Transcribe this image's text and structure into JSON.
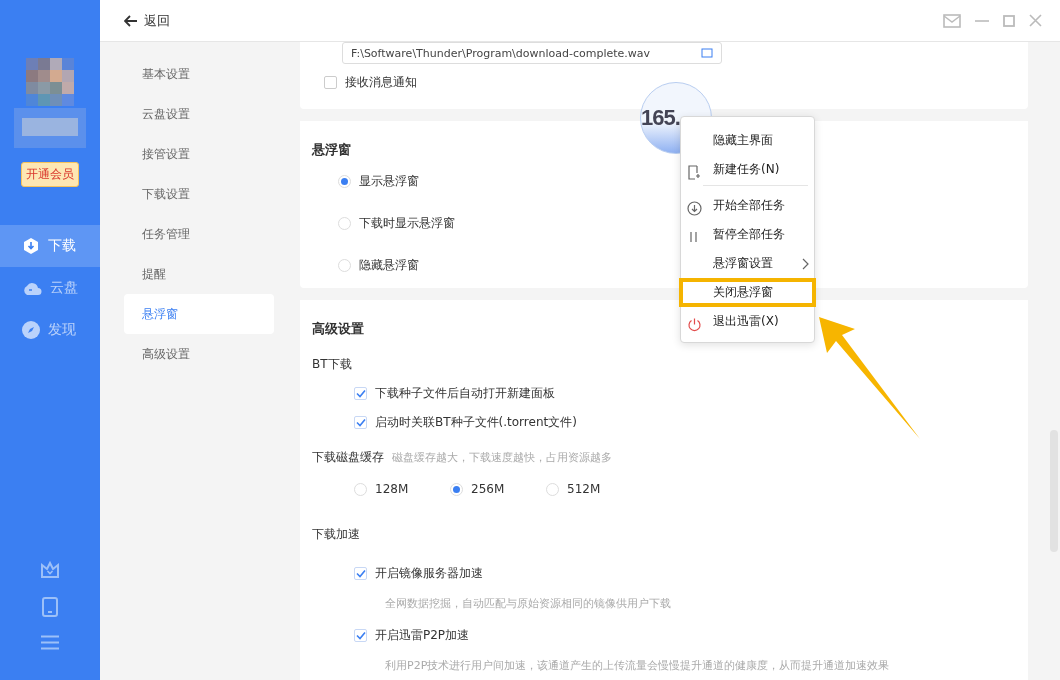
{
  "sidebar": {
    "vip_button": "开通会员",
    "nav": [
      {
        "label": "下载",
        "kind": "download",
        "selected": true
      },
      {
        "label": "云盘",
        "kind": "cloud",
        "selected": false
      },
      {
        "label": "发现",
        "kind": "discover",
        "selected": false
      }
    ]
  },
  "header": {
    "back": "返回"
  },
  "settings_nav": [
    {
      "label": "基本设置",
      "selected": false
    },
    {
      "label": "云盘设置",
      "selected": false
    },
    {
      "label": "接管设置",
      "selected": false
    },
    {
      "label": "下载设置",
      "selected": false
    },
    {
      "label": "任务管理",
      "selected": false
    },
    {
      "label": "提醒",
      "selected": false
    },
    {
      "label": "悬浮窗",
      "selected": true
    },
    {
      "label": "高级设置",
      "selected": false
    }
  ],
  "notify_card": {
    "sound_path": "F:\\Software\\Thunder\\Program\\download-complete.wav",
    "checkbox": {
      "label": "接收消息通知",
      "checked": false
    }
  },
  "float_card": {
    "title": "悬浮窗",
    "options": [
      {
        "label": "显示悬浮窗",
        "selected": true
      },
      {
        "label": "下载时显示悬浮窗",
        "selected": false
      },
      {
        "label": "隐藏悬浮窗",
        "selected": false
      }
    ]
  },
  "advanced_card": {
    "title": "高级设置",
    "bt": {
      "label": "BT下载",
      "checks": [
        {
          "label": "下载种子文件后自动打开新建面板",
          "checked": true
        },
        {
          "label": "启动时关联BT种子文件(.torrent文件)",
          "checked": true
        }
      ]
    },
    "cache": {
      "label": "下载磁盘缓存",
      "hint": "磁盘缓存越大，下载速度越快，占用资源越多",
      "options": [
        {
          "label": "128M",
          "selected": false
        },
        {
          "label": "256M",
          "selected": true
        },
        {
          "label": "512M",
          "selected": false
        }
      ]
    },
    "accel": {
      "label": "下载加速",
      "checks": [
        {
          "label": "开启镜像服务器加速",
          "checked": true,
          "description": "全网数据挖掘，自动匹配与原始资源相同的镜像供用户下载"
        },
        {
          "label": "开启迅雷P2P加速",
          "checked": true,
          "description": "利用P2P技术进行用户间加速，该通道产生的上传流量会慢慢提升通道的健康度，从而提升通道加速效果"
        }
      ]
    }
  },
  "float_ball": {
    "speed": "165."
  },
  "context_menu": {
    "items": [
      {
        "label": "隐藏主界面",
        "kind": "plain",
        "divider_after": false,
        "submenu": false,
        "highlighted": false
      },
      {
        "label": "新建任务(N)",
        "kind": "new-task",
        "divider_after": true,
        "submenu": false,
        "highlighted": false
      },
      {
        "label": "开始全部任务",
        "kind": "start",
        "divider_after": false,
        "submenu": false,
        "highlighted": false
      },
      {
        "label": "暂停全部任务",
        "kind": "pause",
        "divider_after": false,
        "submenu": false,
        "highlighted": false
      },
      {
        "label": "悬浮窗设置",
        "kind": "plain",
        "divider_after": false,
        "submenu": true,
        "highlighted": false
      },
      {
        "label": "关闭悬浮窗",
        "kind": "plain",
        "divider_after": false,
        "submenu": false,
        "highlighted": true
      },
      {
        "label": "退出迅雷(X)",
        "kind": "exit",
        "divider_after": false,
        "submenu": false,
        "highlighted": false
      }
    ]
  }
}
